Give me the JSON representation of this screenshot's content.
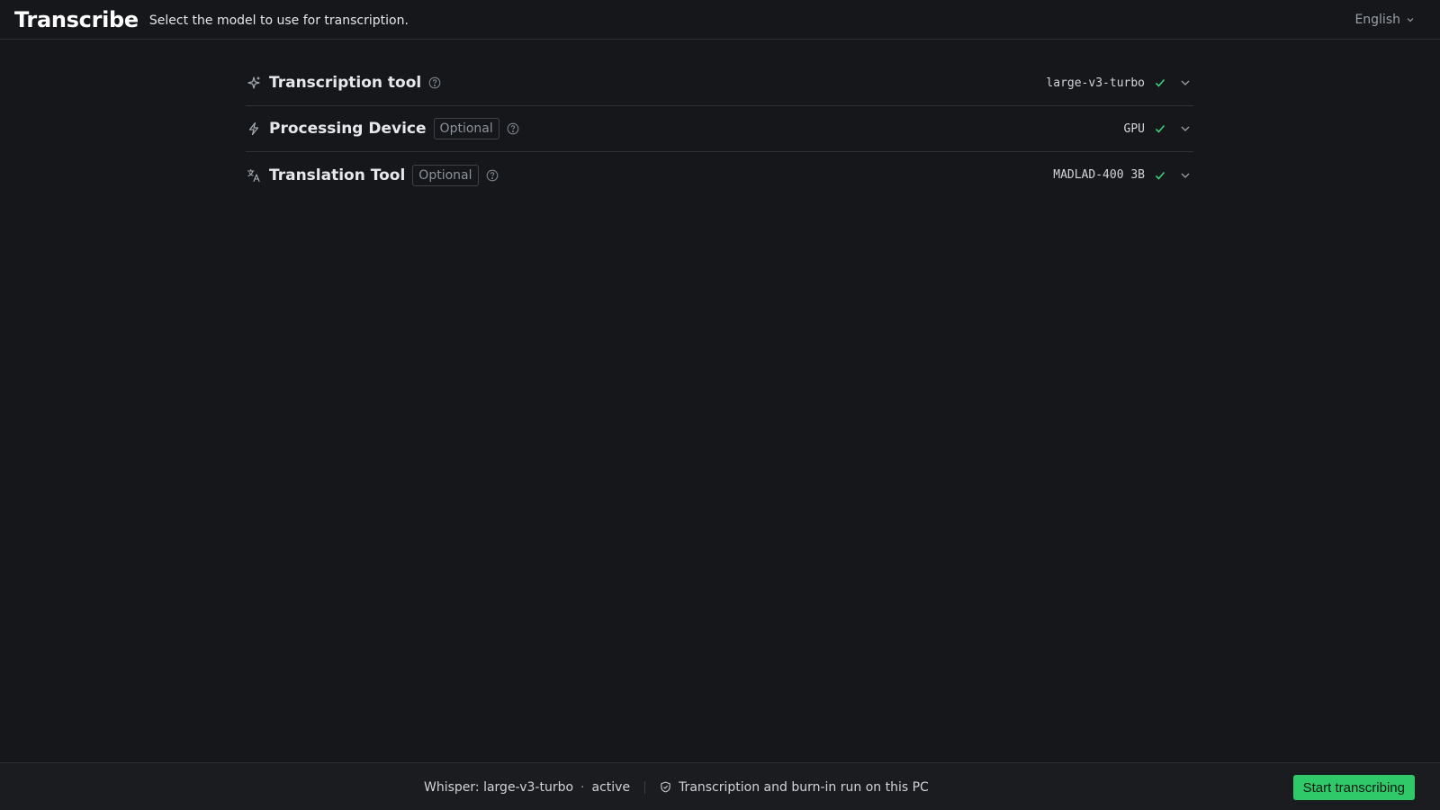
{
  "header": {
    "title": "Transcribe",
    "subtitle": "Select the model to use for transcription.",
    "language": "English"
  },
  "rows": [
    {
      "icon": "sparkle-icon",
      "label": "Transcription tool",
      "badge": "",
      "value": "large-v3-turbo",
      "status": "ready"
    },
    {
      "icon": "lightning-icon",
      "label": "Processing Device",
      "badge": "Optional",
      "value": "GPU",
      "status": "ready"
    },
    {
      "icon": "translate-icon",
      "label": "Translation Tool",
      "badge": "Optional",
      "value": "MADLAD-400 3B",
      "status": "ready"
    }
  ],
  "footer": {
    "engine": "Whisper: large-v3-turbo",
    "engine_state": "active",
    "dot": "·",
    "privacy_note": "Transcription and burn-in run on this PC",
    "start_label": "Start transcribing"
  },
  "colors": {
    "background": "#15171b",
    "accent": "#2fc96a",
    "check": "#3fcf7a"
  }
}
